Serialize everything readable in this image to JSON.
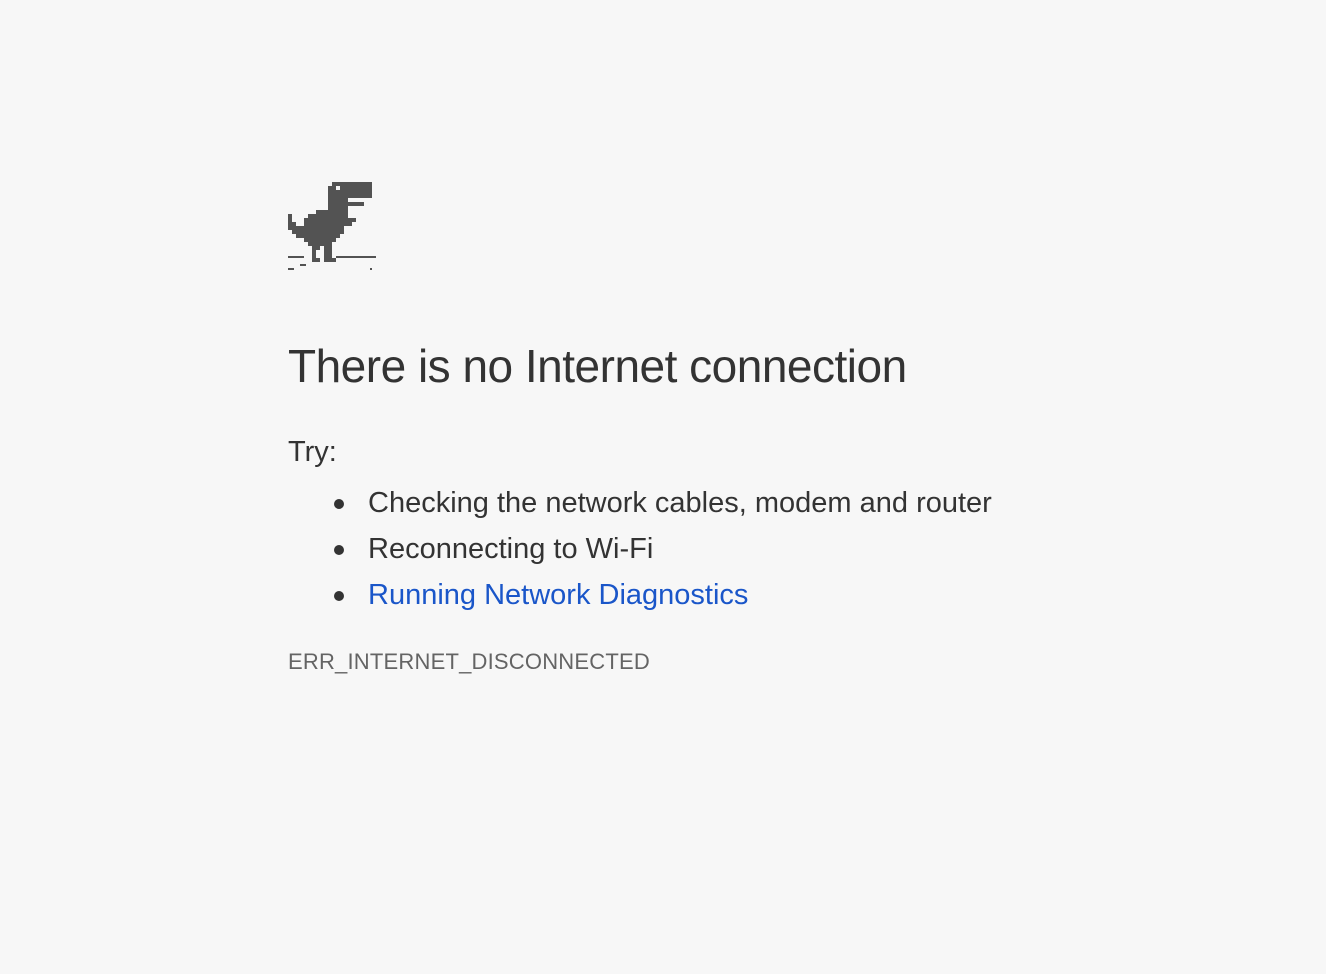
{
  "page": {
    "background": "#f7f7f7"
  },
  "icon": {
    "name": "offline-dino-icon",
    "color": "#535353"
  },
  "title": "There is no Internet connection",
  "try_label": "Try:",
  "suggestions": [
    {
      "text": "Checking the network cables, modem and router",
      "is_link": false
    },
    {
      "text": "Reconnecting to Wi-Fi",
      "is_link": false
    },
    {
      "text": "Running Network Diagnostics",
      "is_link": true
    }
  ],
  "colors": {
    "text": "#333333",
    "link": "#1a56c9",
    "error_code": "#646464"
  },
  "error_code": "ERR_INTERNET_DISCONNECTED"
}
